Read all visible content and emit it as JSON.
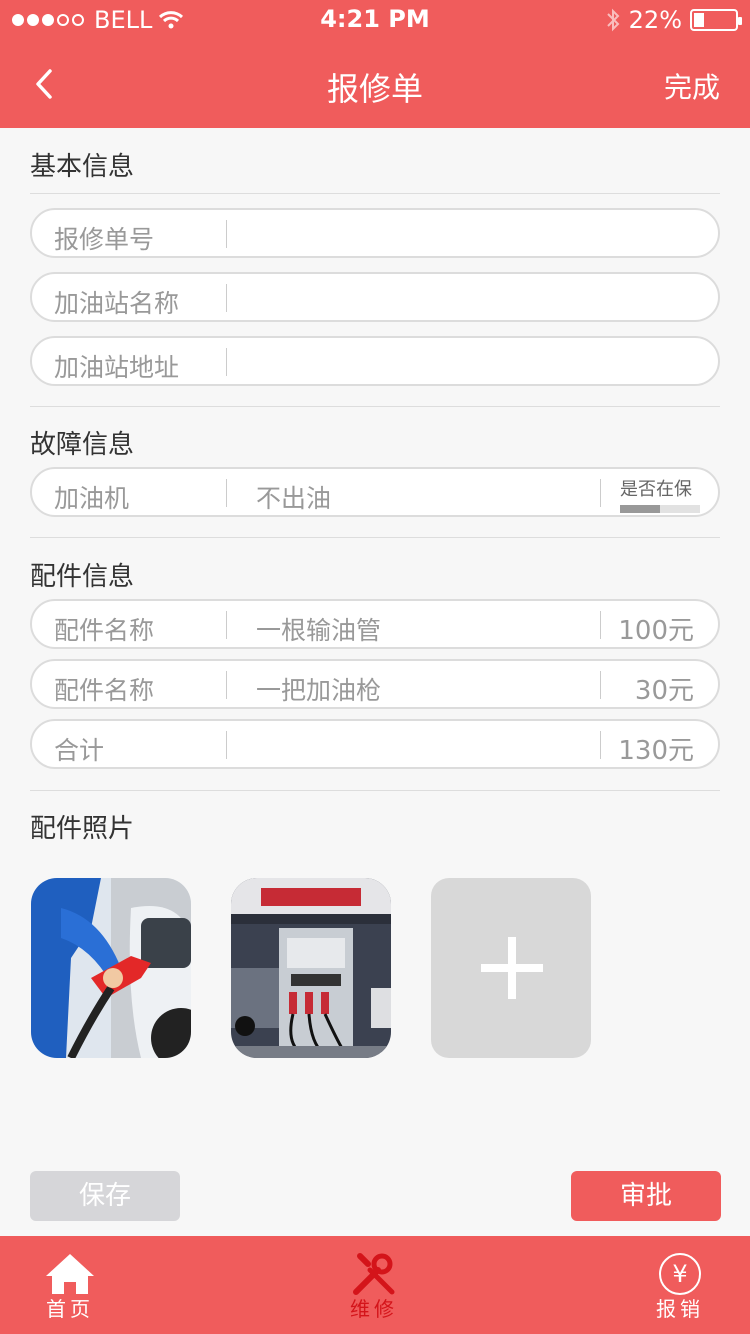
{
  "status_bar": {
    "carrier": "BELL",
    "time": "4:21 PM",
    "battery": "22%",
    "battery_level": 0.22
  },
  "nav": {
    "title": "报修单",
    "done_label": "完成"
  },
  "basic_info": {
    "title": "基本信息",
    "fields": [
      {
        "label": "报修单号"
      },
      {
        "label": "加油站名称"
      },
      {
        "label": "加油站地址"
      }
    ]
  },
  "fault_info": {
    "title": "故障信息",
    "label": "加油机",
    "value": "不出油",
    "warranty_label": "是否在保",
    "warranty_level": 0.5
  },
  "parts_info": {
    "title": "配件信息",
    "rows": [
      {
        "label": "配件名称",
        "value": "一根输油管",
        "amount": "100元"
      },
      {
        "label": "配件名称",
        "value": "一把加油枪",
        "amount": "30元"
      },
      {
        "label": "合计",
        "value": "",
        "amount": "130元"
      }
    ]
  },
  "photos": {
    "title": "配件照片"
  },
  "buttons": {
    "save": "保存",
    "approve": "审批"
  },
  "tabbar": {
    "home": "首页",
    "repair": "维修",
    "reimburse": "报销",
    "currency_symbol": "¥"
  },
  "colors": {
    "brand": "#f05c5c",
    "active_tab": "#d4141a"
  }
}
